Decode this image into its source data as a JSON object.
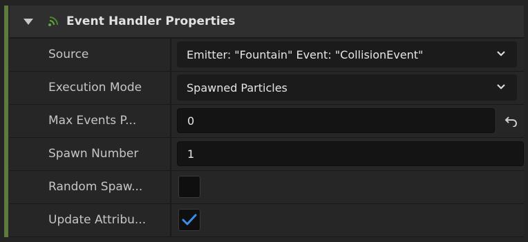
{
  "header": {
    "title": "Event Handler Properties",
    "collapse_icon": "triangle-down-icon",
    "event_icon": "event-signal-icon",
    "accent_color": "#5f7a3d"
  },
  "rows": [
    {
      "label": "Source",
      "type": "combo",
      "value": "Emitter: \"Fountain\" Event: \"CollisionEvent\""
    },
    {
      "label": "Execution Mode",
      "type": "combo",
      "value": "Spawned Particles"
    },
    {
      "label": "Max Events P...",
      "type": "number",
      "value": "0",
      "has_reset": true
    },
    {
      "label": "Spawn Number",
      "type": "number",
      "value": "1"
    },
    {
      "label": "Random Spaw...",
      "type": "checkbox",
      "checked": false
    },
    {
      "label": "Update Attribu...",
      "type": "checkbox",
      "checked": true
    }
  ],
  "icons": {
    "dropdown": "chevron-down-icon",
    "reset": "reset-arrow-icon",
    "check": "checkmark-icon"
  },
  "colors": {
    "check": "#3d8ee8",
    "signal": "#5fa83a"
  }
}
